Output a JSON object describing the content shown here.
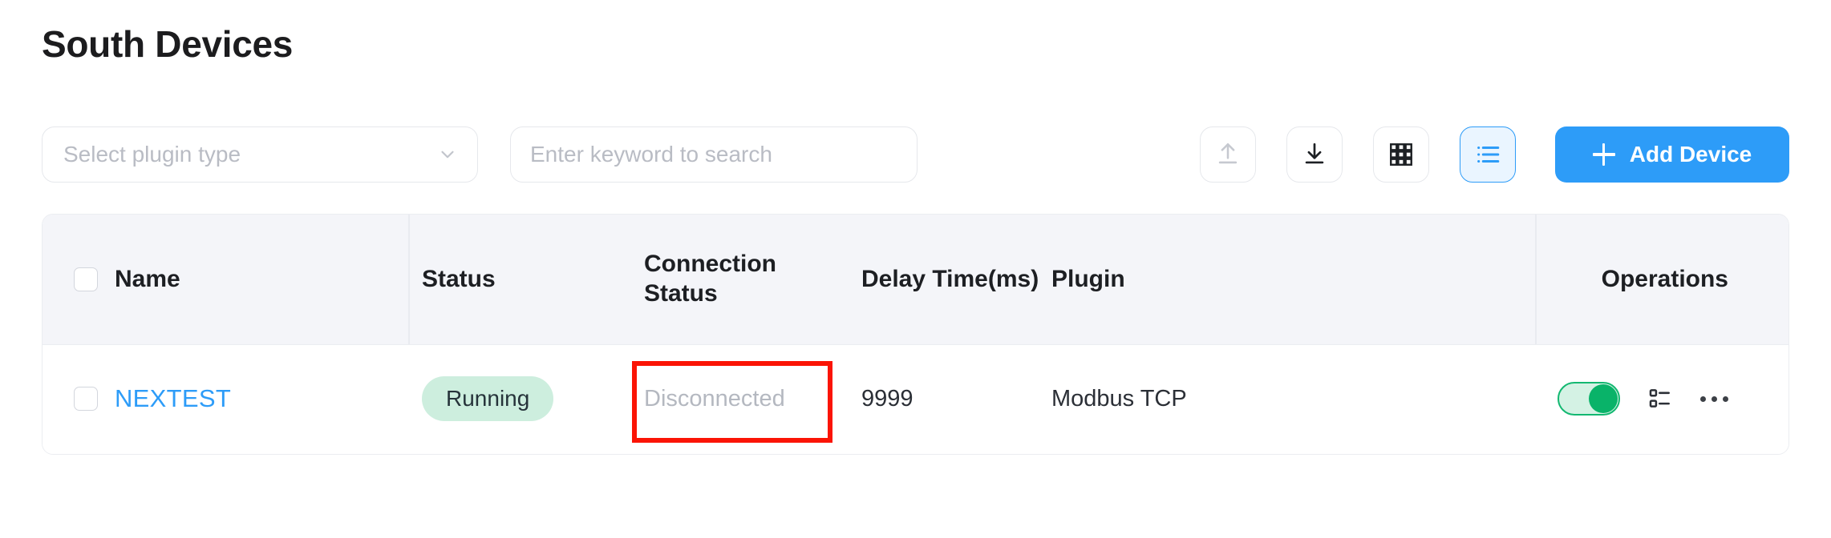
{
  "header": {
    "title": "South Devices"
  },
  "toolbar": {
    "plugin_select": {
      "placeholder": "Select plugin type",
      "value": "",
      "icon": "chevron-down-icon"
    },
    "search": {
      "placeholder": "Enter keyword to search",
      "value": ""
    },
    "buttons": [
      {
        "name": "upload-button",
        "icon": "upload-icon",
        "label": "",
        "state": "disabled"
      },
      {
        "name": "download-button",
        "icon": "download-icon",
        "label": "",
        "state": "enabled"
      },
      {
        "name": "grid-view-button",
        "icon": "grid-view-icon",
        "label": "",
        "state": "enabled"
      },
      {
        "name": "list-view-button",
        "icon": "list-view-icon",
        "label": "",
        "state": "active"
      }
    ],
    "add_device": {
      "label": "Add Device",
      "icon": "plus-icon",
      "color": "#2d9cf8"
    }
  },
  "table": {
    "select_all_checkbox": false,
    "columns": [
      {
        "key": "name",
        "label": "Name"
      },
      {
        "key": "status",
        "label": "Status"
      },
      {
        "key": "conn",
        "label": "Connection Status"
      },
      {
        "key": "delay",
        "label": "Delay Time(ms)"
      },
      {
        "key": "plugin",
        "label": "Plugin"
      },
      {
        "key": "oper",
        "label": "Operations"
      }
    ],
    "rows": [
      {
        "checked": false,
        "name": "NEXTEST",
        "status": "Running",
        "status_color": "#cdeede",
        "connection_status": "Disconnected",
        "connection_color": "#b4b8c0",
        "delay_time": "9999",
        "plugin": "Modbus TCP",
        "toggle_on": true,
        "toggle_color": "#09b369",
        "operations": [
          "data-points-icon",
          "more-options-icon"
        ]
      }
    ]
  },
  "annotation": {
    "target": "connection-status-cell",
    "color": "#fb1405"
  }
}
